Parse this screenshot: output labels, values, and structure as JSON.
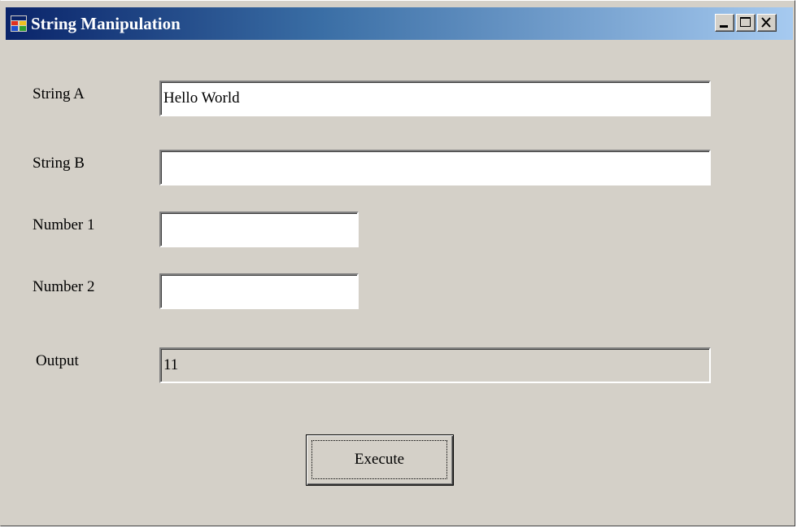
{
  "window": {
    "title": "String Manipulation",
    "app_icon": "windows-form-icon",
    "controls": [
      "minimize-icon",
      "maximize-icon",
      "close-icon"
    ]
  },
  "form": {
    "string_a": {
      "label": "String A",
      "value": "Hello World"
    },
    "string_b": {
      "label": "String B",
      "value": ""
    },
    "number_1": {
      "label": "Number 1",
      "value": ""
    },
    "number_2": {
      "label": "Number 2",
      "value": ""
    },
    "output": {
      "label": "Output",
      "value": "11"
    },
    "execute_label": "Execute"
  },
  "colors": {
    "face": "#d4d0c8",
    "title_start": "#0a246a",
    "title_end": "#a6caf0"
  }
}
